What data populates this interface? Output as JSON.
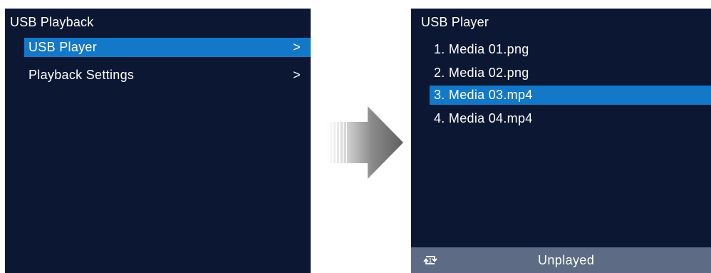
{
  "left_screen": {
    "title": "USB Playback",
    "items": [
      {
        "label": "USB Player",
        "chevron": ">",
        "selected": true
      },
      {
        "label": "Playback Settings",
        "chevron": ">",
        "selected": false
      }
    ]
  },
  "right_screen": {
    "title": "USB Player",
    "items": [
      {
        "label": "1. Media 01.png",
        "selected": false
      },
      {
        "label": "2. Media 02.png",
        "selected": false
      },
      {
        "label": "3. Media 03.mp4",
        "selected": true
      },
      {
        "label": "4. Media 04.mp4",
        "selected": false
      }
    ],
    "status": {
      "icon": "repeat-one-icon",
      "icon_glyph": "1",
      "text": "Unplayed"
    }
  },
  "transition_arrow": {
    "icon": "arrow-right-icon"
  },
  "colors": {
    "screen_background": "#0b1733",
    "selection": "#1478c8",
    "status_bar": "#5d6b84",
    "text": "#ffffff",
    "arrow_dark": "#6a6a6a",
    "arrow_light": "#f2f2f2"
  }
}
